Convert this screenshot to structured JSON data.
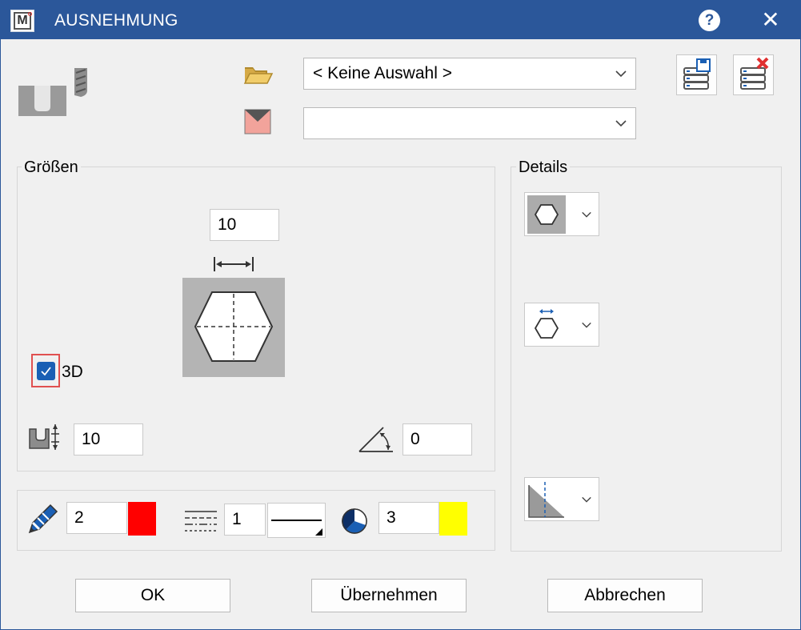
{
  "window": {
    "title": "AUSNEHMUNG",
    "help_label": "?",
    "close_label": "✕",
    "app_icon_letter": "M",
    "accent_color": "#2b579a"
  },
  "top": {
    "folder_combo_value": "< Keine Auswahl >",
    "style_combo_value": ""
  },
  "groups": {
    "sizes_label": "Größen",
    "details_label": "Details"
  },
  "sizes": {
    "width_value": "10",
    "depth_value": "10",
    "angle_value": "0",
    "checkbox_3d_label": "3D",
    "checkbox_3d_checked": true
  },
  "pen_row": {
    "pen_value": "2",
    "pen_color": "#ff0000",
    "line_value": "1",
    "fill_value": "3",
    "fill_color": "#ffff00"
  },
  "buttons": {
    "ok": "OK",
    "apply": "Übernehmen",
    "cancel": "Abbrechen"
  },
  "icons": {
    "folder": "folder-open-icon",
    "style": "style-marker-icon",
    "save_db": "database-save-icon",
    "delete_db": "database-delete-icon",
    "pen": "pen-icon",
    "line_type": "line-type-icon",
    "fill": "fill-pie-icon",
    "depth": "depth-icon",
    "angle": "angle-icon"
  }
}
